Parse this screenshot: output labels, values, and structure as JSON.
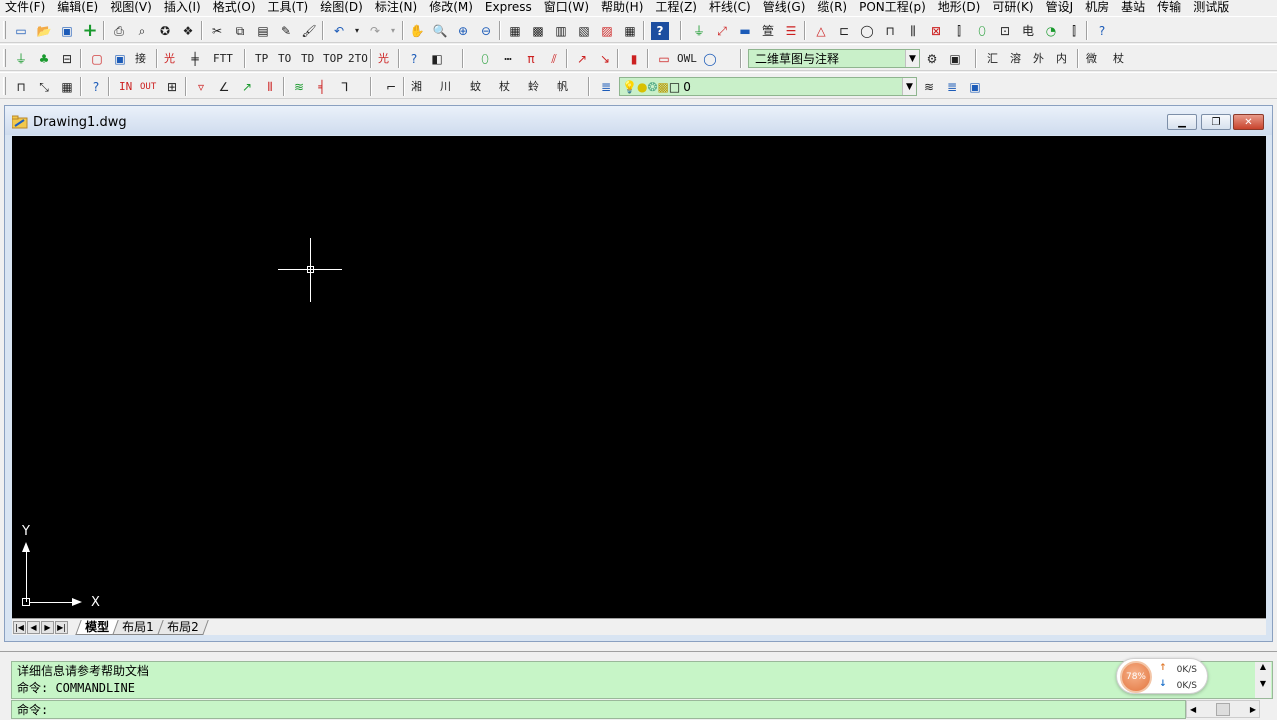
{
  "menubar": [
    "文件(F)",
    "编辑(E)",
    "视图(V)",
    "插入(I)",
    "格式(O)",
    "工具(T)",
    "绘图(D)",
    "标注(N)",
    "修改(M)",
    "Express",
    "窗口(W)",
    "帮助(H)",
    "工程(Z)",
    "杆线(C)",
    "管线(G)",
    "缆(R)",
    "PON工程(p)",
    "地形(D)",
    "可研(K)",
    "管设J",
    "机房",
    "基站",
    "传输",
    "测试版"
  ],
  "toolbar1": {
    "icons": [
      "new-icon",
      "open-icon",
      "save-icon",
      "add-icon",
      "print-icon",
      "preview-icon",
      "publish-icon",
      "plot-icon",
      "cut-icon",
      "copy-icon",
      "paste-icon",
      "matchprop-icon",
      "brush-icon",
      "undo-icon",
      "redo-icon",
      "pan-icon",
      "zoom-realtime-icon",
      "zoom-window-icon",
      "zoom-previous-icon",
      "properties-icon",
      "designcenter-icon",
      "toolpalette-icon",
      "sheetset-icon",
      "markup-icon",
      "calculator-icon",
      "help-icon"
    ]
  },
  "toolbar2": {
    "style_combo": "二维草图与注释",
    "text_buttons": [
      "接",
      "光",
      "FTT",
      "TP",
      "TO",
      "TD",
      "TOP",
      "2TO",
      "光",
      "OWL",
      "汇",
      "溶",
      "外",
      "内",
      "微",
      "杖"
    ]
  },
  "toolbar3": {
    "text_buttons": [
      "IN",
      "OUT",
      "湘",
      "川",
      "蚊",
      "杖",
      "蛉",
      "帆"
    ],
    "layer_combo": "0"
  },
  "drawing": {
    "title": "Drawing1.dwg",
    "ucs_x": "X",
    "ucs_y": "Y",
    "tabs": [
      "模型",
      "布局1",
      "布局2"
    ]
  },
  "command": {
    "history": [
      "详细信息请参考帮助文档",
      "命令: COMMANDLINE"
    ],
    "prompt": "命令:"
  },
  "net_widget": {
    "percent": "78%",
    "up_speed": "0K/S",
    "down_speed": "0K/S"
  }
}
